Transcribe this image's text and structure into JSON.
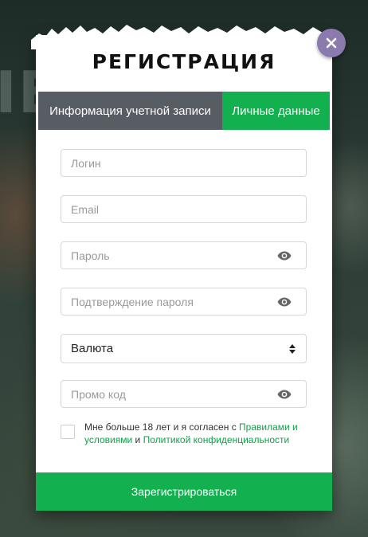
{
  "modal": {
    "title": "РЕГИСТРАЦИЯ",
    "close_icon": "close-icon"
  },
  "tabs": [
    {
      "label": "Информация учетной записи",
      "active": false
    },
    {
      "label": "Личные данные",
      "active": true
    }
  ],
  "form": {
    "login_placeholder": "Логин",
    "email_placeholder": "Email",
    "password_placeholder": "Пароль",
    "confirm_placeholder": "Подтверждение пароля",
    "currency_value": "Валюта",
    "promo_placeholder": "Промо код",
    "eye_icon": "eye-icon"
  },
  "agreement": {
    "text_before": "Мне больше 18 лет и я согласен с ",
    "rules_link": "Правилами и условиями",
    "text_middle": " и ",
    "privacy_link": "Политикой конфиденциальности"
  },
  "submit_label": "Зарегистрироваться",
  "colors": {
    "accent": "#12b04e",
    "tab_inactive": "#585c63",
    "close_button": "#8a7aad"
  }
}
